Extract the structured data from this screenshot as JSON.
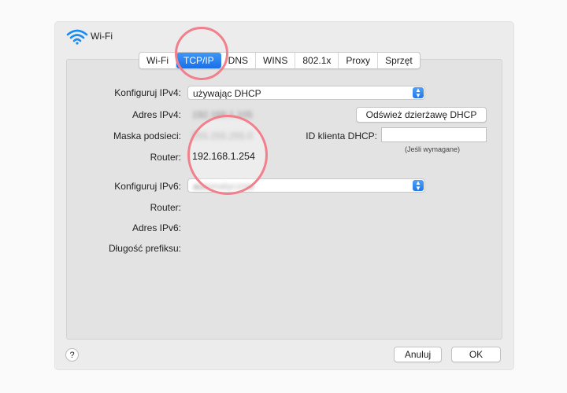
{
  "window": {
    "title": "Wi-Fi"
  },
  "tabs": [
    {
      "label": "Wi-Fi"
    },
    {
      "label": "TCP/IP",
      "selected": true
    },
    {
      "label": "DNS"
    },
    {
      "label": "WINS"
    },
    {
      "label": "802.1x"
    },
    {
      "label": "Proxy"
    },
    {
      "label": "Sprzęt"
    }
  ],
  "ipv4": {
    "configure_label": "Konfiguruj IPv4:",
    "configure_value": "używając DHCP",
    "address_label": "Adres IPv4:",
    "address_value": "192.168.1.105",
    "mask_label": "Maska podsieci:",
    "mask_value": "255.255.255.0",
    "router_label": "Router:",
    "router_value": "192.168.1.254",
    "renew_button": "Odśwież dzierżawę DHCP",
    "client_id_label": "ID klienta DHCP:",
    "client_id_value": "",
    "client_id_note": "(Jeśli wymagane)"
  },
  "ipv6": {
    "configure_label": "Konfiguruj IPv6:",
    "configure_value": "automatycznie",
    "router_label": "Router:",
    "address_label": "Adres IPv6:",
    "prefix_label": "Długość prefiksu:"
  },
  "footer": {
    "help": "?",
    "cancel": "Anuluj",
    "ok": "OK"
  },
  "colors": {
    "accent": "#1a6fe8",
    "highlight_circle": "#f27f8c"
  }
}
